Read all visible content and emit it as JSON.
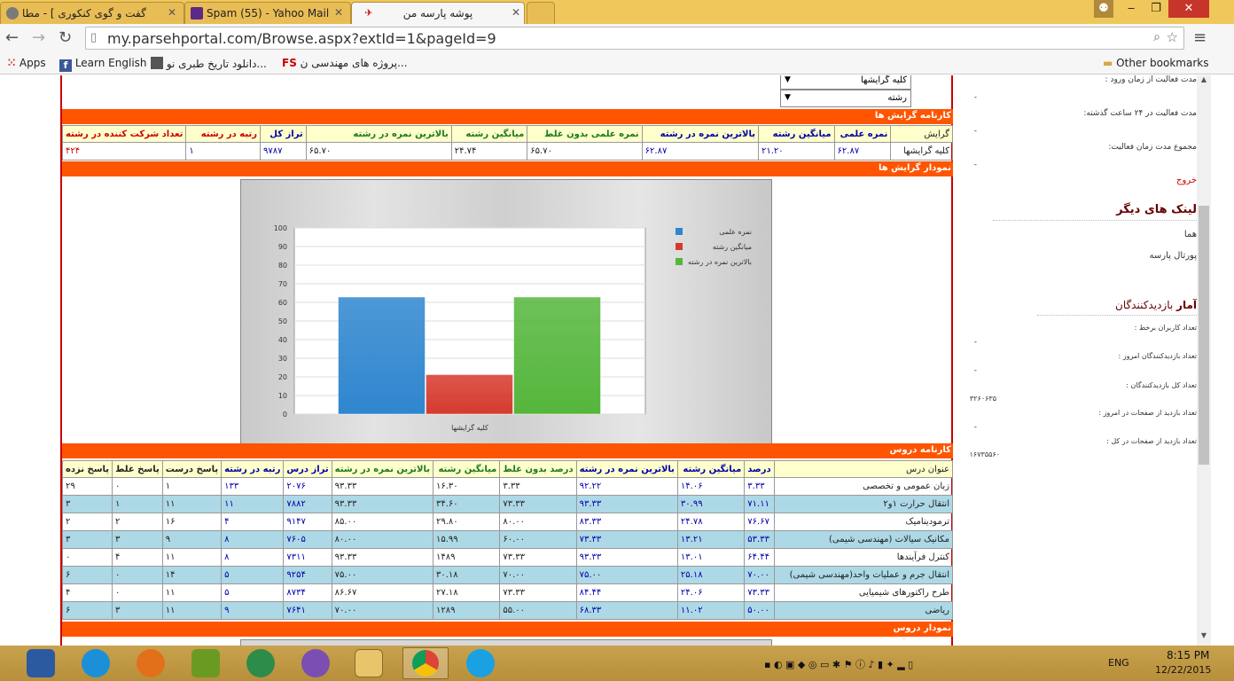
{
  "browser": {
    "tabs": [
      {
        "label": "گفت و گوی کنکوری ] - مطا"
      },
      {
        "label": "Spam (55) - Yahoo Mail"
      },
      {
        "label": "پوشه پارسه من"
      }
    ],
    "url": "my.parsehportal.com/Browse.aspx?extId=1&pageId=9",
    "bookmarks": {
      "apps": "Apps",
      "learn_english": "Learn English",
      "history_download": "دانلود تاریخ طبری نو...",
      "fs_item": "پروژه های مهندسی ن...",
      "other": "Other bookmarks"
    }
  },
  "filters": {
    "orientation_select": "کلیه گرایشها",
    "major_select": "رشته"
  },
  "orientation_report": {
    "title": "کارنامه گرایش ها",
    "headers": [
      "گرایش",
      "نمره علمی",
      "میانگین رشته",
      "بالاترین نمره در رشته",
      "نمره علمی بدون غلط",
      "میانگین رشته",
      "بالاترین نمره در رشته",
      "تراز کل",
      "رتبه در رشته",
      "تعداد شرکت کننده در رشته"
    ],
    "row": [
      "کلیه گرایشها",
      "۶۲.۸۷",
      "۲۱.۲۰",
      "۶۲.۸۷",
      "۶۵.۷۰",
      "۲۴.۷۴",
      "۶۵.۷۰",
      "۹۷۸۷",
      "۱",
      "۴۲۴"
    ]
  },
  "orientation_chart_bar": {
    "title": "نمودار گرایش ها"
  },
  "chart_data": {
    "type": "bar",
    "categories": [
      "کلیه گرایشها"
    ],
    "series": [
      {
        "name": "نمره علمی",
        "values": [
          62.87
        ],
        "color": "#2f86cf"
      },
      {
        "name": "میانگین رشته",
        "values": [
          21.2
        ],
        "color": "#d63a2e"
      },
      {
        "name": "بالاترین نمره در رشته",
        "values": [
          62.87
        ],
        "color": "#55b63c"
      }
    ],
    "ylim": [
      0,
      100
    ],
    "yticks": [
      "0",
      "10",
      "20",
      "30",
      "40",
      "50",
      "60",
      "70",
      "80",
      "90",
      "100"
    ],
    "grid": true,
    "legend": "top-right"
  },
  "course_report": {
    "title": "کارنامه دروس",
    "headers": [
      "عنوان درس",
      "درصد",
      "میانگین رشته",
      "بالاترین نمره در رشته",
      "درصد بدون غلط",
      "میانگین رشته",
      "بالاترین نمره در رشته",
      "تراز درس",
      "رتبه در رشته",
      "پاسخ درست",
      "پاسخ غلط",
      "پاسخ نزده"
    ],
    "rows": [
      [
        "زبان عمومی و تخصصی",
        "۳.۳۳",
        "۱۴.۰۶",
        "۹۲.۲۲",
        "۳.۳۳",
        "۱۶.۳۰",
        "۹۳.۳۳",
        "۲۰۷۶",
        "۱۳۳",
        "۱",
        "۰",
        "۲۹"
      ],
      [
        "انتقال حرارت ۱و۲",
        "۷۱.۱۱",
        "۳۰.۹۹",
        "۹۳.۳۳",
        "۷۳.۳۳",
        "۳۴.۶۰",
        "۹۳.۳۳",
        "۷۸۸۲",
        "۱۱",
        "۱۱",
        "۱",
        "۳"
      ],
      [
        "ترمودینامیک",
        "۷۶.۶۷",
        "۲۴.۷۸",
        "۸۳.۳۳",
        "۸۰.۰۰",
        "۲۹.۸۰",
        "۸۵.۰۰",
        "۹۱۴۷",
        "۴",
        "۱۶",
        "۲",
        "۲"
      ],
      [
        "مکانیک سیالات (مهندسی شیمی)",
        "۵۳.۳۳",
        "۱۳.۲۱",
        "۷۳.۳۳",
        "۶۰.۰۰",
        "۱۵.۹۹",
        "۸۰.۰۰",
        "۷۶۰۵",
        "۸",
        "۹",
        "۳",
        "۳"
      ],
      [
        "کنترل فرآیندها",
        "۶۴.۴۴",
        "۱۳.۰۱",
        "۹۳.۳۳",
        "۷۳.۳۳",
        "۱۴۸۹",
        "۹۳.۳۳",
        "۷۳۱۱",
        "۸",
        "۱۱",
        "۴",
        "۰"
      ],
      [
        "انتقال جرم و عملیات واحد(مهندسی شیمی)",
        "۷۰.۰۰",
        "۲۵.۱۸",
        "۷۵.۰۰",
        "۷۰.۰۰",
        "۳۰.۱۸",
        "۷۵.۰۰",
        "۹۲۵۴",
        "۵",
        "۱۴",
        "۰",
        "۶"
      ],
      [
        "طرح راکتورهای شیمیایی",
        "۷۳.۳۳",
        "۲۴.۰۶",
        "۸۴.۴۴",
        "۷۳.۳۳",
        "۲۷.۱۸",
        "۸۶.۶۷",
        "۸۷۳۴",
        "۵",
        "۱۱",
        "۰",
        "۴"
      ],
      [
        "ریاضی",
        "۵۰.۰۰",
        "۱۱.۰۲",
        "۶۸.۳۳",
        "۵۵.۰۰",
        "۱۲۸۹",
        "۷۰.۰۰",
        "۷۶۴۱",
        "۹",
        "۱۱",
        "۳",
        "۶"
      ]
    ]
  },
  "course_chart_bar": {
    "title": "نمودار دروس"
  },
  "sidebar": {
    "activity_since_login": "مدت فعالیت از زمان ورود :",
    "dash1": "-",
    "activity_24h": "مدت فعالیت در ۲۴ ساعت گذشته:",
    "dash2": "-",
    "total_activity": "مجموع مدت زمان فعالیت:",
    "dash3": "-",
    "logout": "خروج",
    "other_links_title": "لینک های دیگر",
    "link1": "هما",
    "link2": "پورتال پارسه",
    "stats_title_bold": "آمار",
    "stats_title_rest": " بازدیدکنندگان",
    "online_users": "تعداد کاربران برخط :",
    "dash4": "-",
    "visitors_today": "تعداد بازدیدکنندگان امروز :",
    "dash5": "-",
    "visitors_total": "تعداد کل بازدیدکنندگان :",
    "visitors_total_val": "۳۲۶۰۶۳۵",
    "page_visits_today": "تعداد بازدید از صفحات در امروز :",
    "dash6": "-",
    "page_visits_total": "تعداد بازدید از صفحات در کل :",
    "page_visits_total_val": "۱۶۷۳۵۵۶۰"
  },
  "taskbar": {
    "lang": "ENG",
    "time": "8:15 PM",
    "date": "12/22/2015"
  }
}
